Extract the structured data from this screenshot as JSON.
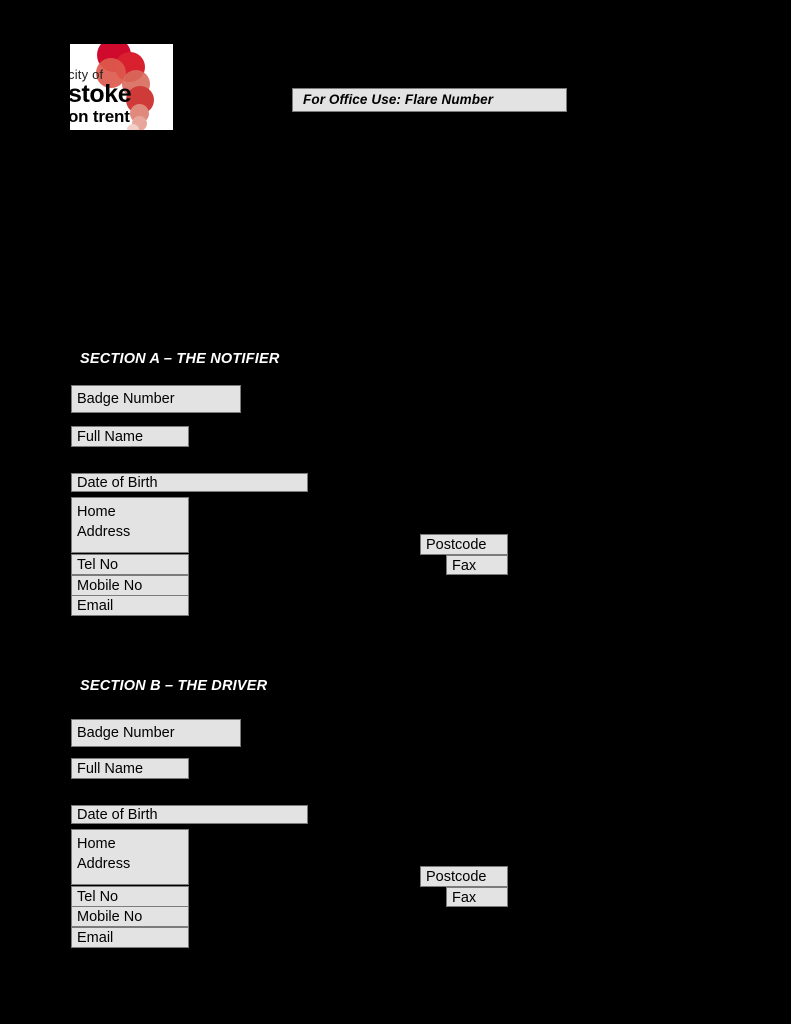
{
  "page": {
    "background_color": "#000000",
    "field_fill_color": "#e3e3e3",
    "field_border_color": "#7b7b7b",
    "text_color": "#000000",
    "heading_color": "#ffffff"
  },
  "logo": {
    "line1": "city of",
    "line2": "stoke",
    "line3": "on trent",
    "accent_color": "#cf0a2c",
    "panel_background": "#ffffff"
  },
  "office_use": {
    "label": "For Office Use:  Flare Number"
  },
  "sections": [
    {
      "title": "SECTION A – THE NOTIFIER",
      "fields": {
        "badge_number": "Badge Number",
        "full_name": "Full Name",
        "date_of_birth": "Date of Birth",
        "home_address": "Home\nAddress",
        "tel_no": "Tel No",
        "mobile_no": "Mobile No",
        "email": "Email",
        "postcode": "Postcode",
        "fax": "Fax"
      }
    },
    {
      "title": "SECTION B – THE DRIVER",
      "fields": {
        "badge_number": "Badge Number",
        "full_name": "Full Name",
        "date_of_birth": "Date of Birth",
        "home_address": "Home\nAddress",
        "tel_no": "Tel No",
        "mobile_no": "Mobile No",
        "email": "Email",
        "postcode": "Postcode",
        "fax": "Fax"
      }
    }
  ]
}
